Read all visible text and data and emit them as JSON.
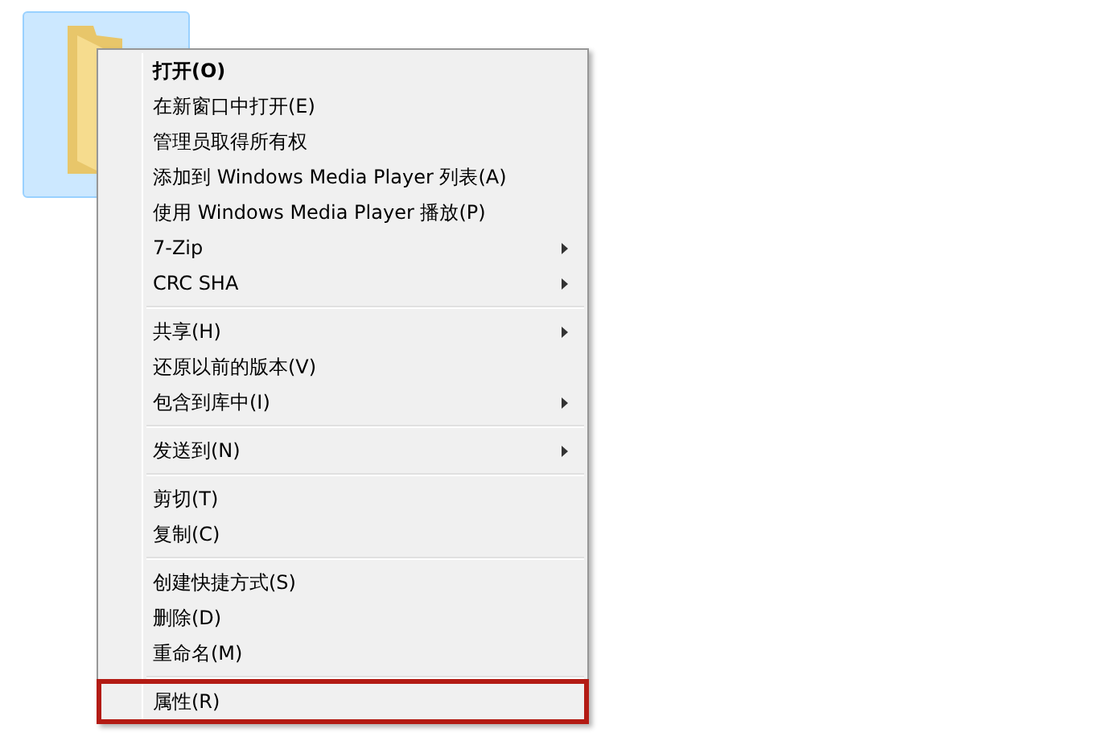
{
  "desktop_item": {
    "kind": "folder",
    "selected": true
  },
  "context_menu": {
    "groups": [
      {
        "items": [
          {
            "label": "打开(O)",
            "default": true,
            "has_submenu": false,
            "highlighted": false
          },
          {
            "label": "在新窗口中打开(E)",
            "default": false,
            "has_submenu": false,
            "highlighted": false
          },
          {
            "label": "管理员取得所有权",
            "default": false,
            "has_submenu": false,
            "highlighted": false
          },
          {
            "label": "添加到 Windows Media Player 列表(A)",
            "default": false,
            "has_submenu": false,
            "highlighted": false
          },
          {
            "label": "使用 Windows Media Player 播放(P)",
            "default": false,
            "has_submenu": false,
            "highlighted": false
          },
          {
            "label": "7-Zip",
            "default": false,
            "has_submenu": true,
            "highlighted": false
          },
          {
            "label": "CRC SHA",
            "default": false,
            "has_submenu": true,
            "highlighted": false
          }
        ]
      },
      {
        "items": [
          {
            "label": "共享(H)",
            "default": false,
            "has_submenu": true,
            "highlighted": false
          },
          {
            "label": "还原以前的版本(V)",
            "default": false,
            "has_submenu": false,
            "highlighted": false
          },
          {
            "label": "包含到库中(I)",
            "default": false,
            "has_submenu": true,
            "highlighted": false
          }
        ]
      },
      {
        "items": [
          {
            "label": "发送到(N)",
            "default": false,
            "has_submenu": true,
            "highlighted": false
          }
        ]
      },
      {
        "items": [
          {
            "label": "剪切(T)",
            "default": false,
            "has_submenu": false,
            "highlighted": false
          },
          {
            "label": "复制(C)",
            "default": false,
            "has_submenu": false,
            "highlighted": false
          }
        ]
      },
      {
        "items": [
          {
            "label": "创建快捷方式(S)",
            "default": false,
            "has_submenu": false,
            "highlighted": false
          },
          {
            "label": "删除(D)",
            "default": false,
            "has_submenu": false,
            "highlighted": false
          },
          {
            "label": "重命名(M)",
            "default": false,
            "has_submenu": false,
            "highlighted": false
          }
        ]
      },
      {
        "items": [
          {
            "label": "属性(R)",
            "default": false,
            "has_submenu": false,
            "highlighted": true
          }
        ]
      }
    ]
  }
}
